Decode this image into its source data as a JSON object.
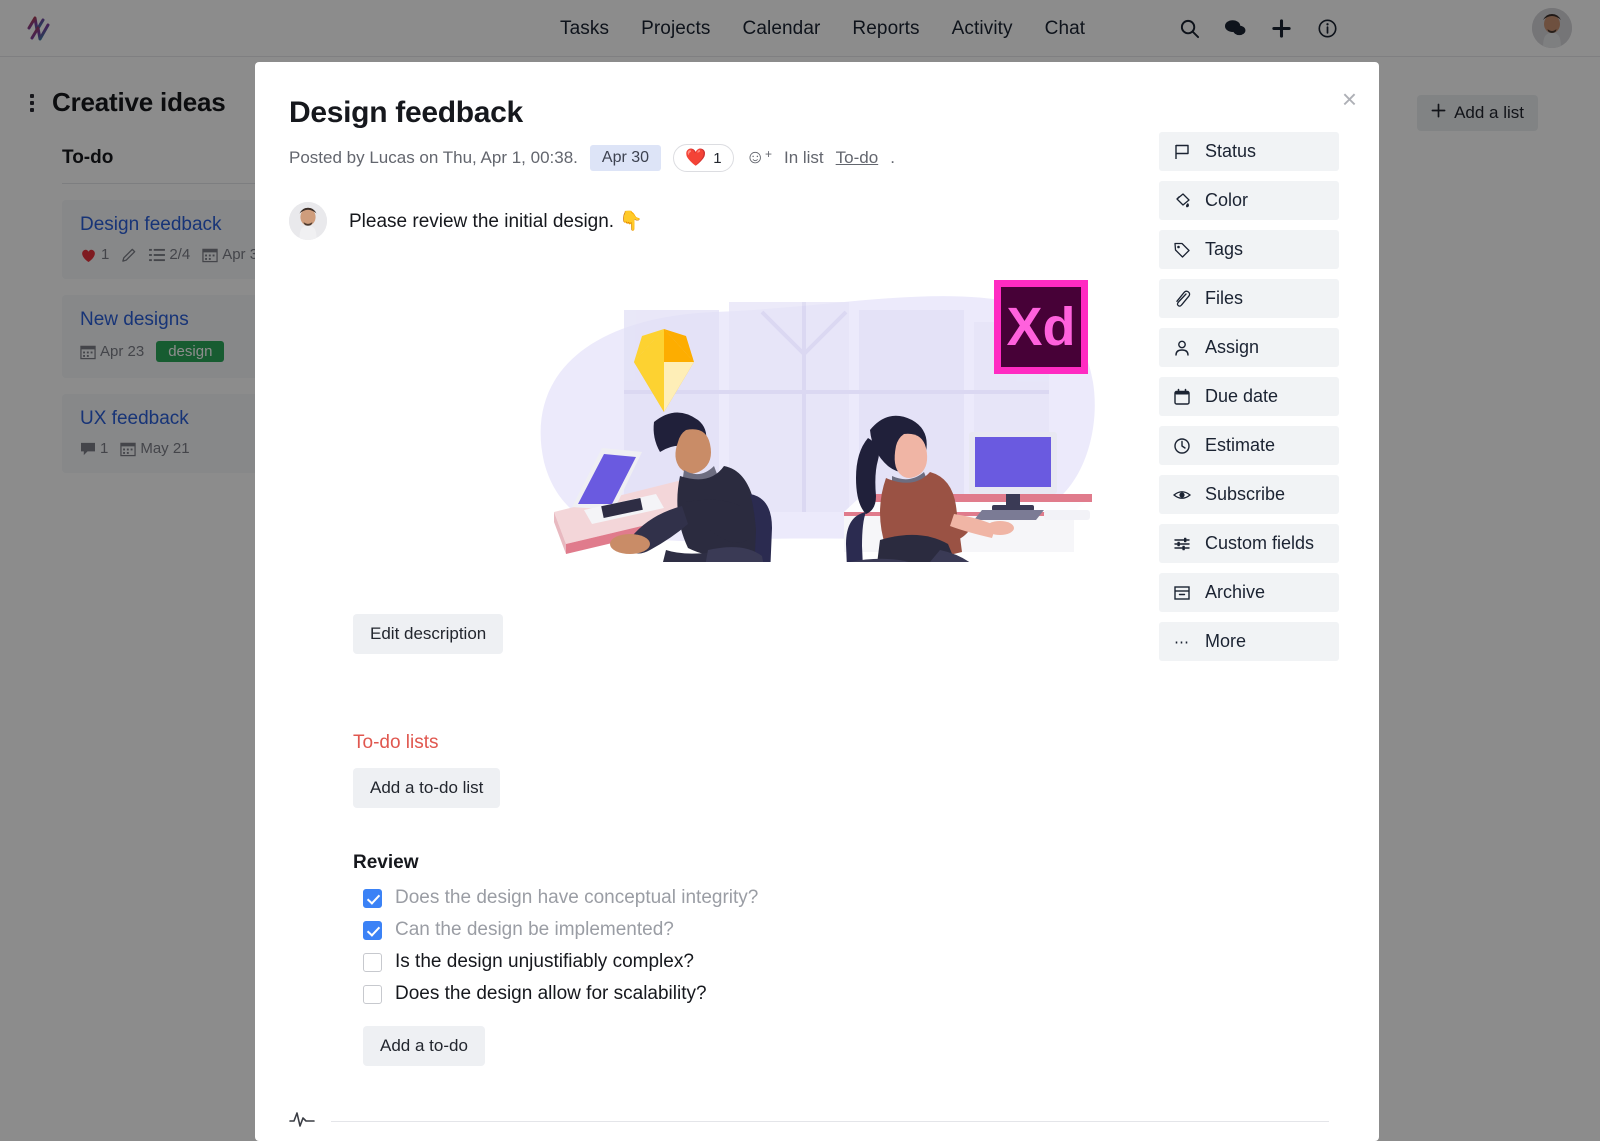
{
  "topbar": {
    "logo_icon": "zigzag-logo-icon",
    "nav_links": [
      "Tasks",
      "Projects",
      "Calendar",
      "Reports",
      "Activity",
      "Chat"
    ],
    "icons": [
      "search-icon",
      "chat-icon",
      "plus-icon",
      "info-icon"
    ],
    "avatar_alt": "user-avatar"
  },
  "board": {
    "title": "Creative ideas",
    "add_list_label": "Add a list",
    "column": {
      "title": "To-do",
      "cards": [
        {
          "title": "Design feedback",
          "heart_count": "1",
          "checklist": "2/4",
          "date": "Apr 3",
          "has_pencil": true
        },
        {
          "title": "New designs",
          "date": "Apr 23",
          "tag": "design"
        },
        {
          "title": "UX feedback",
          "comment_count": "1",
          "date": "May 21"
        }
      ]
    }
  },
  "modal": {
    "close_label": "×",
    "title": "Design feedback",
    "posted_by": "Posted by Lucas on Thu, Apr 1, 00:38.",
    "date_pill": "Apr 30",
    "reaction_emoji": "❤️",
    "reaction_count": "1",
    "in_list_prefix": "In list",
    "in_list_name": "To-do",
    "in_list_suffix": ".",
    "comment": {
      "text": "Please review the initial design.",
      "emoji": "👇"
    },
    "illustration_alt": "designers-at-desks-illustration",
    "illustration_badges": {
      "sketch": "sketch-diamond-logo",
      "xd_label": "Xd"
    },
    "edit_description_label": "Edit description",
    "todo_section": {
      "heading": "To-do lists",
      "add_list_label": "Add a to-do list",
      "list_name": "Review",
      "items": [
        {
          "label": "Does the design have conceptual integrity?",
          "checked": true
        },
        {
          "label": "Can the design be implemented?",
          "checked": true
        },
        {
          "label": "Is the design unjustifiably complex?",
          "checked": false
        },
        {
          "label": "Does the design allow for scalability?",
          "checked": false
        }
      ],
      "add_todo_label": "Add a to-do"
    },
    "activity_icon": "pulse-icon",
    "side_menu": [
      {
        "label": "Status",
        "icon": "flag-icon"
      },
      {
        "label": "Color",
        "icon": "paint-bucket-icon"
      },
      {
        "label": "Tags",
        "icon": "tag-icon"
      },
      {
        "label": "Files",
        "icon": "paperclip-icon"
      },
      {
        "label": "Assign",
        "icon": "person-icon"
      },
      {
        "label": "Due date",
        "icon": "calendar-icon"
      },
      {
        "label": "Estimate",
        "icon": "clock-icon"
      },
      {
        "label": "Subscribe",
        "icon": "eye-icon"
      },
      {
        "label": "Custom fields",
        "icon": "sliders-icon"
      },
      {
        "label": "Archive",
        "icon": "archive-icon"
      },
      {
        "label": "More",
        "icon": "ellipsis-icon"
      }
    ]
  },
  "colors": {
    "link_blue": "#2b5fd9",
    "accent_red": "#e0574f",
    "tag_green": "#2aa85a",
    "checkbox_blue": "#3b82f6",
    "date_pill_bg": "#dde4f7"
  }
}
